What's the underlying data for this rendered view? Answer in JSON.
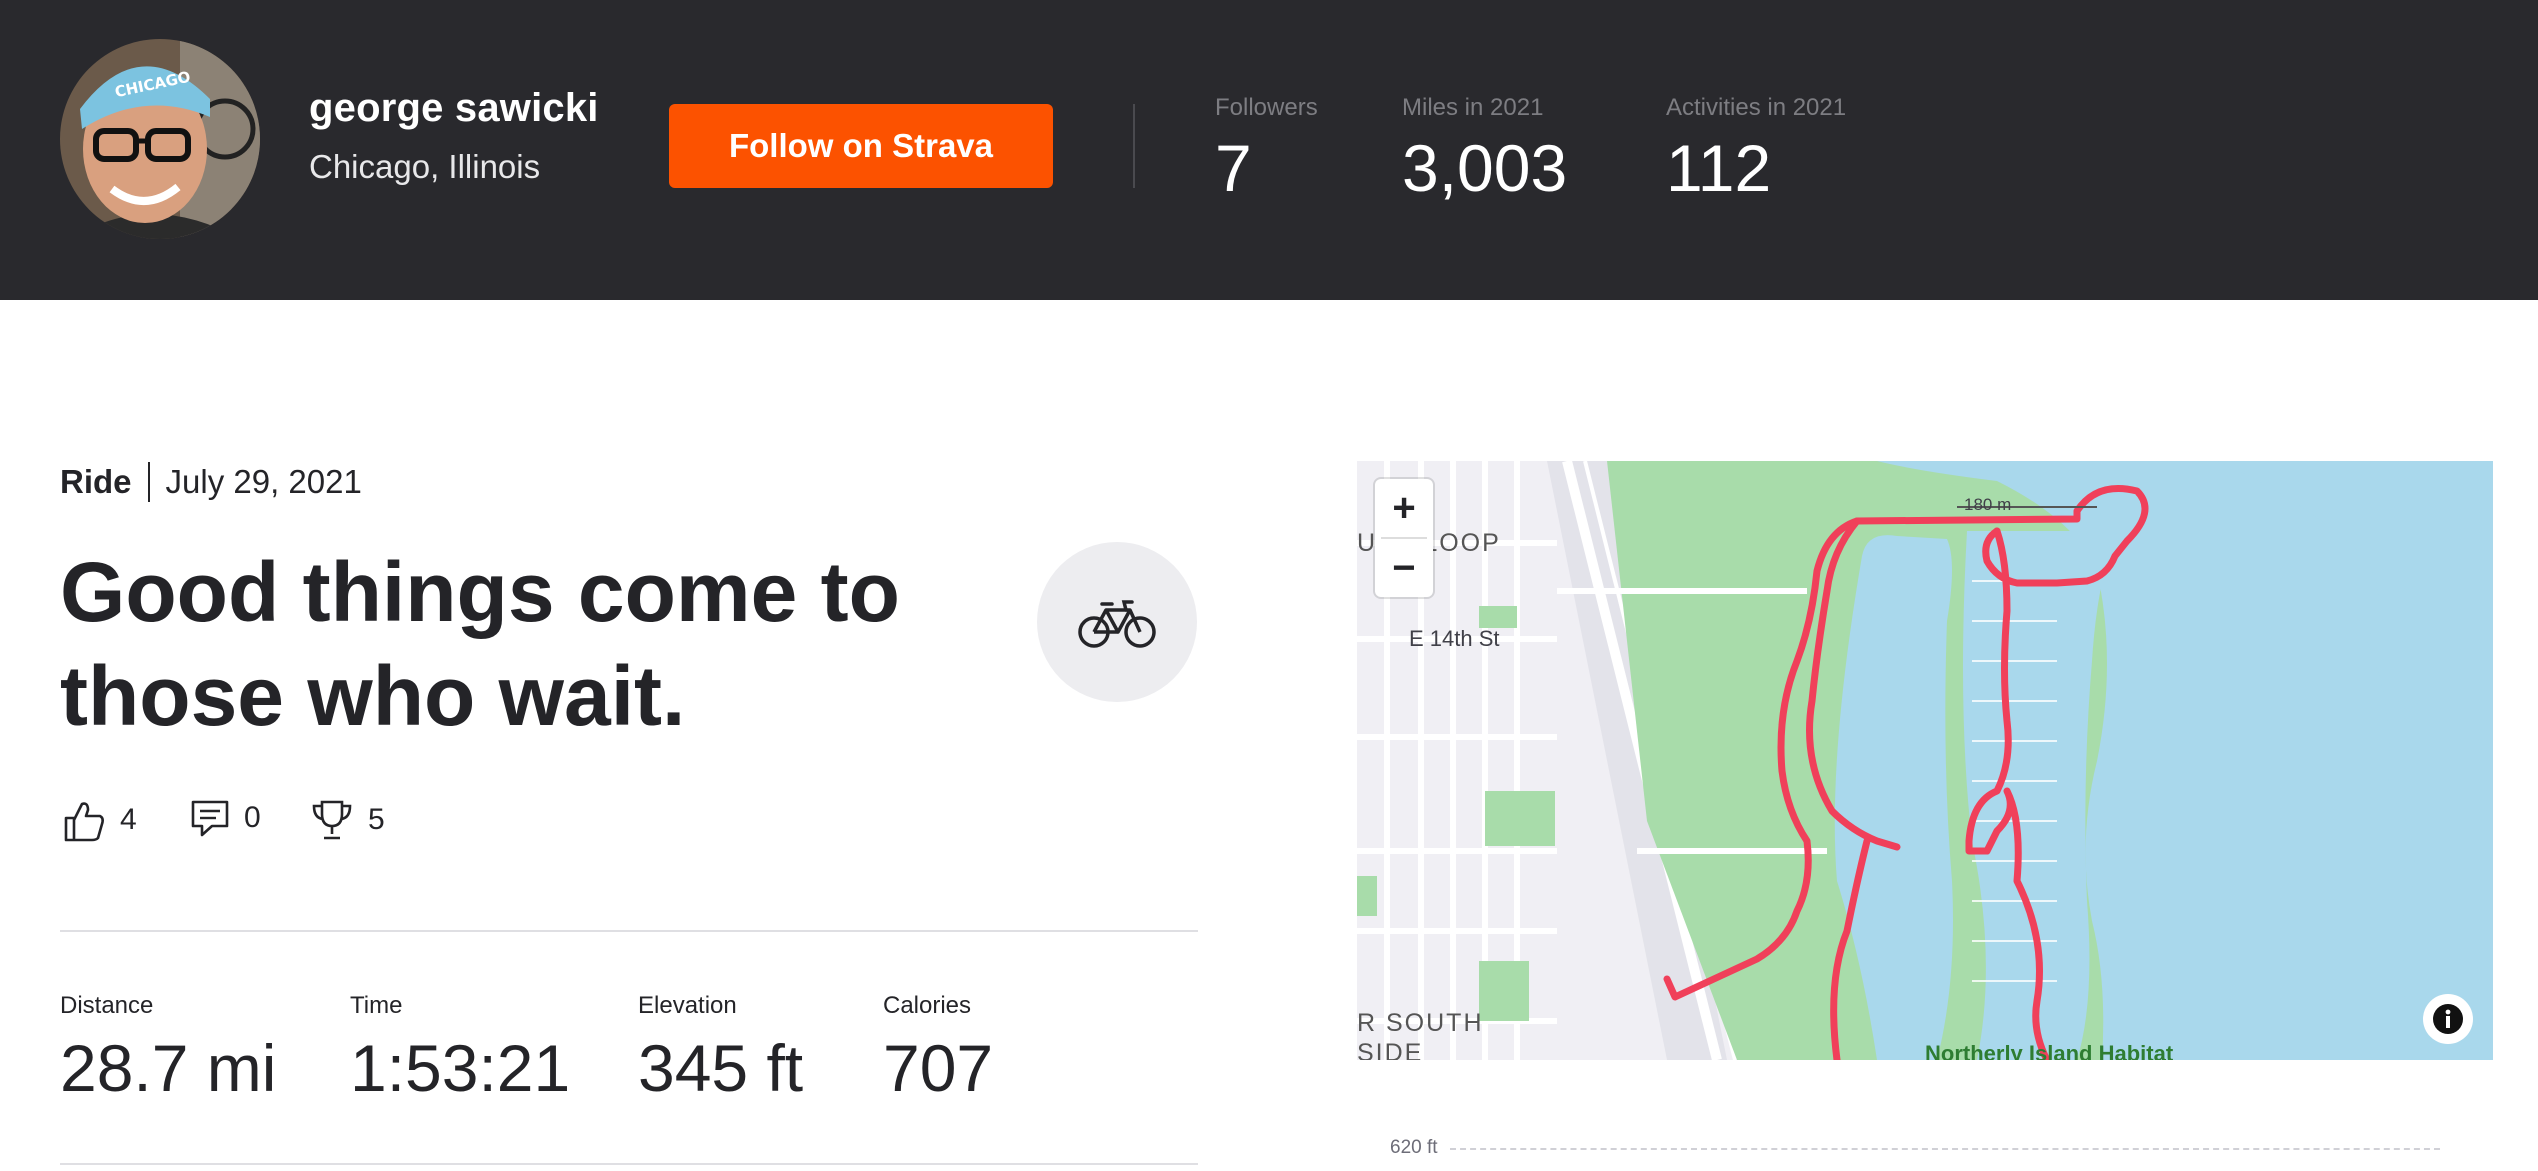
{
  "athlete": {
    "name": "george sawicki",
    "location": "Chicago, Illinois",
    "follow_label": "Follow on Strava",
    "cap_text": "CHICAGO"
  },
  "header_stats": [
    {
      "label": "Followers",
      "value": "7"
    },
    {
      "label": "Miles in 2021",
      "value": "3,003"
    },
    {
      "label": "Activities in 2021",
      "value": "112"
    }
  ],
  "activity": {
    "type": "Ride",
    "date": "July 29, 2021",
    "title": "Good things come to those who wait.",
    "sport_icon": "bike-icon",
    "kudos": "4",
    "comments": "0",
    "achievements": "5"
  },
  "metrics": [
    {
      "label": "Distance",
      "value": "28.7 mi"
    },
    {
      "label": "Time",
      "value": "1:53:21"
    },
    {
      "label": "Elevation",
      "value": "345 ft"
    },
    {
      "label": "Calories",
      "value": "707"
    }
  ],
  "map": {
    "zoom_in": "+",
    "zoom_out": "−",
    "labels": {
      "loop": "UTH LOOP",
      "street": "E 14th St",
      "south_side_1": "R SOUTH",
      "south_side_2": "SIDE",
      "scale": "180 m",
      "habitat": "Northerly Island Habitat"
    },
    "route_color": "#f0405a",
    "water_color": "#a9d8ec",
    "park_color": "#a8dcaa"
  },
  "elevation_chart": {
    "top_label": "620 ft"
  },
  "colors": {
    "brand": "#fc5200",
    "header_bg": "#29292d"
  }
}
